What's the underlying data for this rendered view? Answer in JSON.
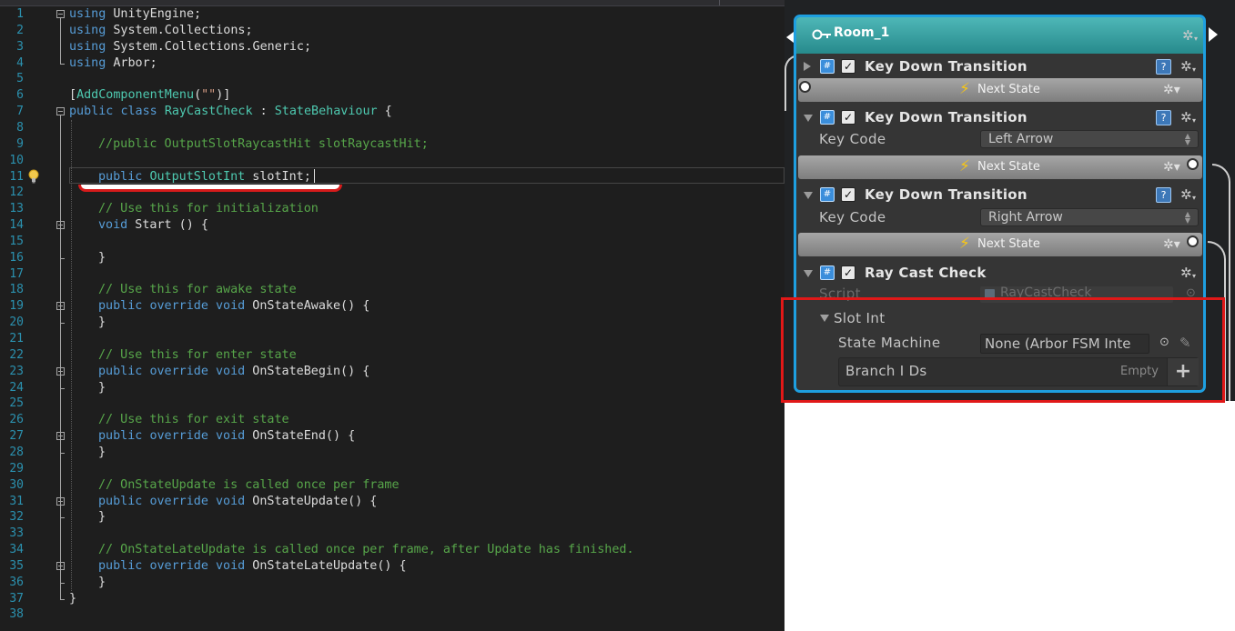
{
  "editor": {
    "lines": [
      {
        "n": "1",
        "tokens": [
          {
            "t": "using",
            "c": "kw"
          },
          {
            "t": " UnityEngine;",
            "c": ""
          }
        ]
      },
      {
        "n": "2",
        "tokens": [
          {
            "t": "using",
            "c": "kw"
          },
          {
            "t": " System.Collections;",
            "c": ""
          }
        ]
      },
      {
        "n": "3",
        "tokens": [
          {
            "t": "using",
            "c": "kw"
          },
          {
            "t": " System.Collections.Generic;",
            "c": ""
          }
        ]
      },
      {
        "n": "4",
        "tokens": [
          {
            "t": "using",
            "c": "kw"
          },
          {
            "t": " Arbor;",
            "c": ""
          }
        ]
      },
      {
        "n": "5",
        "tokens": []
      },
      {
        "n": "6",
        "tokens": [
          {
            "t": "[",
            "c": ""
          },
          {
            "t": "AddComponentMenu",
            "c": "ty"
          },
          {
            "t": "(",
            "c": ""
          },
          {
            "t": "\"\"",
            "c": "st"
          },
          {
            "t": ")]",
            "c": ""
          }
        ]
      },
      {
        "n": "7",
        "tokens": [
          {
            "t": "public",
            "c": "kw"
          },
          {
            "t": " ",
            "c": ""
          },
          {
            "t": "class",
            "c": "kw"
          },
          {
            "t": " ",
            "c": ""
          },
          {
            "t": "RayCastCheck",
            "c": "ty"
          },
          {
            "t": " : ",
            "c": ""
          },
          {
            "t": "StateBehaviour",
            "c": "ty"
          },
          {
            "t": " {",
            "c": ""
          }
        ]
      },
      {
        "n": "8",
        "tokens": []
      },
      {
        "n": "9",
        "tokens": [
          {
            "t": "//public OutputSlotRaycastHit slotRaycastHit;",
            "c": "cm"
          }
        ]
      },
      {
        "n": "10",
        "tokens": []
      },
      {
        "n": "11",
        "tokens": [
          {
            "t": "public",
            "c": "kw"
          },
          {
            "t": " ",
            "c": ""
          },
          {
            "t": "OutputSlotInt",
            "c": "ty"
          },
          {
            "t": " slotInt;",
            "c": ""
          }
        ]
      },
      {
        "n": "12",
        "tokens": []
      },
      {
        "n": "13",
        "tokens": [
          {
            "t": "// Use this for initialization",
            "c": "cm"
          }
        ]
      },
      {
        "n": "14",
        "tokens": [
          {
            "t": "void",
            "c": "kw"
          },
          {
            "t": " Start () {",
            "c": ""
          }
        ]
      },
      {
        "n": "15",
        "tokens": []
      },
      {
        "n": "16",
        "tokens": [
          {
            "t": "}",
            "c": ""
          }
        ]
      },
      {
        "n": "17",
        "tokens": []
      },
      {
        "n": "18",
        "tokens": [
          {
            "t": "// Use this for awake state",
            "c": "cm"
          }
        ]
      },
      {
        "n": "19",
        "tokens": [
          {
            "t": "public",
            "c": "kw"
          },
          {
            "t": " ",
            "c": ""
          },
          {
            "t": "override",
            "c": "kw"
          },
          {
            "t": " ",
            "c": ""
          },
          {
            "t": "void",
            "c": "kw"
          },
          {
            "t": " OnStateAwake() {",
            "c": ""
          }
        ]
      },
      {
        "n": "20",
        "tokens": [
          {
            "t": "}",
            "c": ""
          }
        ]
      },
      {
        "n": "21",
        "tokens": []
      },
      {
        "n": "22",
        "tokens": [
          {
            "t": "// Use this for enter state",
            "c": "cm"
          }
        ]
      },
      {
        "n": "23",
        "tokens": [
          {
            "t": "public",
            "c": "kw"
          },
          {
            "t": " ",
            "c": ""
          },
          {
            "t": "override",
            "c": "kw"
          },
          {
            "t": " ",
            "c": ""
          },
          {
            "t": "void",
            "c": "kw"
          },
          {
            "t": " OnStateBegin() {",
            "c": ""
          }
        ]
      },
      {
        "n": "24",
        "tokens": [
          {
            "t": "}",
            "c": ""
          }
        ]
      },
      {
        "n": "25",
        "tokens": []
      },
      {
        "n": "26",
        "tokens": [
          {
            "t": "// Use this for exit state",
            "c": "cm"
          }
        ]
      },
      {
        "n": "27",
        "tokens": [
          {
            "t": "public",
            "c": "kw"
          },
          {
            "t": " ",
            "c": ""
          },
          {
            "t": "override",
            "c": "kw"
          },
          {
            "t": " ",
            "c": ""
          },
          {
            "t": "void",
            "c": "kw"
          },
          {
            "t": " OnStateEnd() {",
            "c": ""
          }
        ]
      },
      {
        "n": "28",
        "tokens": [
          {
            "t": "}",
            "c": ""
          }
        ]
      },
      {
        "n": "29",
        "tokens": []
      },
      {
        "n": "30",
        "tokens": [
          {
            "t": "// OnStateUpdate is called once per frame",
            "c": "cm"
          }
        ]
      },
      {
        "n": "31",
        "tokens": [
          {
            "t": "public",
            "c": "kw"
          },
          {
            "t": " ",
            "c": ""
          },
          {
            "t": "override",
            "c": "kw"
          },
          {
            "t": " ",
            "c": ""
          },
          {
            "t": "void",
            "c": "kw"
          },
          {
            "t": " OnStateUpdate() {",
            "c": ""
          }
        ]
      },
      {
        "n": "32",
        "tokens": [
          {
            "t": "}",
            "c": ""
          }
        ]
      },
      {
        "n": "33",
        "tokens": []
      },
      {
        "n": "34",
        "tokens": [
          {
            "t": "// OnStateLateUpdate is called once per frame, after Update has finished.",
            "c": "cm"
          }
        ]
      },
      {
        "n": "35",
        "tokens": [
          {
            "t": "public",
            "c": "kw"
          },
          {
            "t": " ",
            "c": ""
          },
          {
            "t": "override",
            "c": "kw"
          },
          {
            "t": " ",
            "c": ""
          },
          {
            "t": "void",
            "c": "kw"
          },
          {
            "t": " OnStateLateUpdate() {",
            "c": ""
          }
        ]
      },
      {
        "n": "36",
        "tokens": [
          {
            "t": "}",
            "c": ""
          }
        ]
      },
      {
        "n": "37",
        "tokens": [
          {
            "t": "}",
            "c": ""
          }
        ]
      },
      {
        "n": "38",
        "tokens": []
      }
    ],
    "icons": {
      "lightbulb": "lightbulb-icon"
    }
  },
  "arbor_node": {
    "title": "Room_1",
    "behaviours": [
      {
        "title": "Key Down Transition",
        "enabled": true,
        "expanded": false
      },
      {
        "title": "Key Down Transition",
        "enabled": true,
        "expanded": true,
        "key_code_label": "Key Code",
        "key_code_value": "Left Arrow"
      },
      {
        "title": "Key Down Transition",
        "enabled": true,
        "expanded": true,
        "key_code_label": "Key Code",
        "key_code_value": "Right Arrow"
      },
      {
        "title": "Ray Cast Check",
        "enabled": true,
        "expanded": true
      }
    ],
    "transitions": [
      "Next State",
      "Next State",
      "Next State"
    ],
    "script_label": "Script",
    "script_value": "RayCastCheck",
    "slot_int": {
      "foldout_label": "Slot Int",
      "state_machine_label": "State Machine",
      "state_machine_value": "None (Arbor FSM Inte",
      "branch_ids_label": "Branch I Ds",
      "branch_ids_empty": "Empty",
      "add_label": "+"
    },
    "colors": {
      "header": "#3fa9a9",
      "border": "#1e9fe0",
      "highlight": "#e01818",
      "panel": "#353535"
    }
  }
}
